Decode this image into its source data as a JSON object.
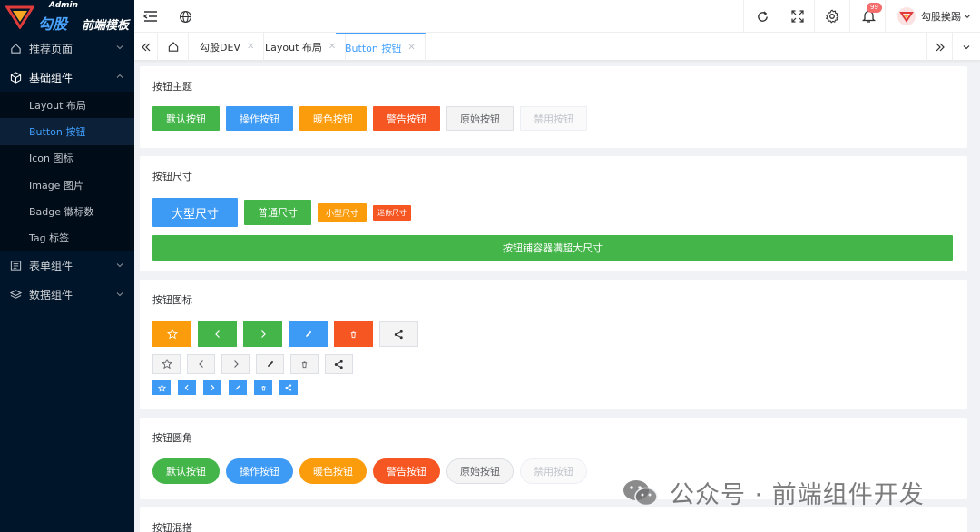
{
  "logo": {
    "admin": "Admin",
    "brand": "勾股",
    "sub": "前端模板"
  },
  "sidebar": {
    "items": [
      {
        "label": "推荐页面",
        "icon": "home-icon"
      },
      {
        "label": "基础组件",
        "icon": "cube-icon"
      },
      {
        "label": "表单组件",
        "icon": "form-icon"
      },
      {
        "label": "数据组件",
        "icon": "layers-icon"
      }
    ],
    "sub_items": [
      "Layout 布局",
      "Button 按钮",
      "Icon 图标",
      "Image 图片",
      "Badge 徽标数",
      "Tag 标签"
    ],
    "active_sub": "Button 按钮"
  },
  "header": {
    "notif_count": "99",
    "user_name": "勾股挨踢"
  },
  "tabs": [
    {
      "label": "勾股DEV"
    },
    {
      "label": "Layout 布局"
    },
    {
      "label": "Button 按钮"
    }
  ],
  "sections": {
    "theme": {
      "title": "按钮主题",
      "buttons": [
        "默认按钮",
        "操作按钮",
        "暖色按钮",
        "警告按钮",
        "原始按钮",
        "禁用按钮"
      ]
    },
    "size": {
      "title": "按钮尺寸",
      "buttons": [
        "大型尺寸",
        "普通尺寸",
        "小型尺寸",
        "迷你尺寸"
      ],
      "block": "按钮铺容器满超大尺寸"
    },
    "icon": {
      "title": "按钮图标"
    },
    "round": {
      "title": "按钮圆角",
      "buttons": [
        "默认按钮",
        "操作按钮",
        "暖色按钮",
        "警告按钮",
        "原始按钮",
        "禁用按钮"
      ]
    },
    "group": {
      "title": "按钮混搭"
    }
  },
  "watermark": "公众号 · 前端组件开发",
  "colors": {
    "success": "#44b549",
    "primary": "#3e9bf5",
    "warning": "#fb9c0c",
    "danger": "#f65722",
    "sidebar": "#001529",
    "active": "#409eff"
  }
}
